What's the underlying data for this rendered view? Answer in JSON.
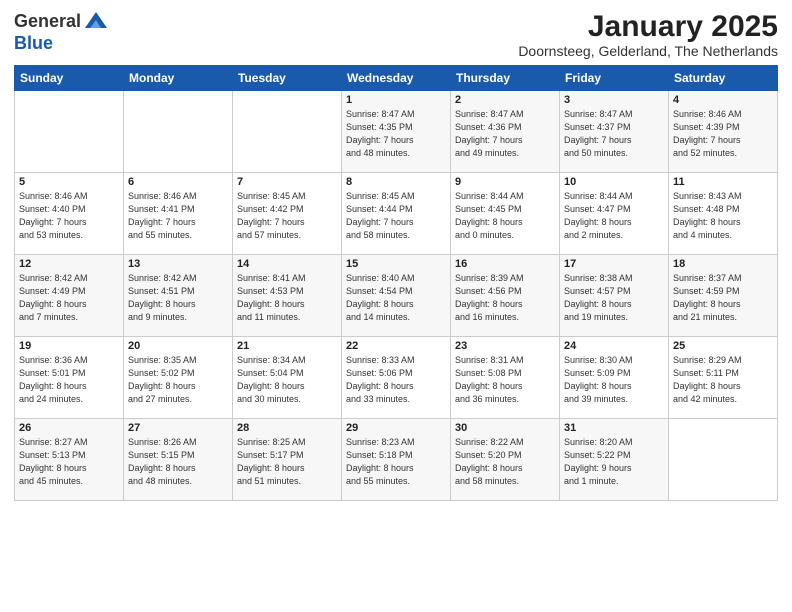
{
  "logo": {
    "line1": "General",
    "line2": "Blue"
  },
  "title": "January 2025",
  "subtitle": "Doornsteeg, Gelderland, The Netherlands",
  "weekdays": [
    "Sunday",
    "Monday",
    "Tuesday",
    "Wednesday",
    "Thursday",
    "Friday",
    "Saturday"
  ],
  "weeks": [
    [
      {
        "day": "",
        "info": ""
      },
      {
        "day": "",
        "info": ""
      },
      {
        "day": "",
        "info": ""
      },
      {
        "day": "1",
        "info": "Sunrise: 8:47 AM\nSunset: 4:35 PM\nDaylight: 7 hours\nand 48 minutes."
      },
      {
        "day": "2",
        "info": "Sunrise: 8:47 AM\nSunset: 4:36 PM\nDaylight: 7 hours\nand 49 minutes."
      },
      {
        "day": "3",
        "info": "Sunrise: 8:47 AM\nSunset: 4:37 PM\nDaylight: 7 hours\nand 50 minutes."
      },
      {
        "day": "4",
        "info": "Sunrise: 8:46 AM\nSunset: 4:39 PM\nDaylight: 7 hours\nand 52 minutes."
      }
    ],
    [
      {
        "day": "5",
        "info": "Sunrise: 8:46 AM\nSunset: 4:40 PM\nDaylight: 7 hours\nand 53 minutes."
      },
      {
        "day": "6",
        "info": "Sunrise: 8:46 AM\nSunset: 4:41 PM\nDaylight: 7 hours\nand 55 minutes."
      },
      {
        "day": "7",
        "info": "Sunrise: 8:45 AM\nSunset: 4:42 PM\nDaylight: 7 hours\nand 57 minutes."
      },
      {
        "day": "8",
        "info": "Sunrise: 8:45 AM\nSunset: 4:44 PM\nDaylight: 7 hours\nand 58 minutes."
      },
      {
        "day": "9",
        "info": "Sunrise: 8:44 AM\nSunset: 4:45 PM\nDaylight: 8 hours\nand 0 minutes."
      },
      {
        "day": "10",
        "info": "Sunrise: 8:44 AM\nSunset: 4:47 PM\nDaylight: 8 hours\nand 2 minutes."
      },
      {
        "day": "11",
        "info": "Sunrise: 8:43 AM\nSunset: 4:48 PM\nDaylight: 8 hours\nand 4 minutes."
      }
    ],
    [
      {
        "day": "12",
        "info": "Sunrise: 8:42 AM\nSunset: 4:49 PM\nDaylight: 8 hours\nand 7 minutes."
      },
      {
        "day": "13",
        "info": "Sunrise: 8:42 AM\nSunset: 4:51 PM\nDaylight: 8 hours\nand 9 minutes."
      },
      {
        "day": "14",
        "info": "Sunrise: 8:41 AM\nSunset: 4:53 PM\nDaylight: 8 hours\nand 11 minutes."
      },
      {
        "day": "15",
        "info": "Sunrise: 8:40 AM\nSunset: 4:54 PM\nDaylight: 8 hours\nand 14 minutes."
      },
      {
        "day": "16",
        "info": "Sunrise: 8:39 AM\nSunset: 4:56 PM\nDaylight: 8 hours\nand 16 minutes."
      },
      {
        "day": "17",
        "info": "Sunrise: 8:38 AM\nSunset: 4:57 PM\nDaylight: 8 hours\nand 19 minutes."
      },
      {
        "day": "18",
        "info": "Sunrise: 8:37 AM\nSunset: 4:59 PM\nDaylight: 8 hours\nand 21 minutes."
      }
    ],
    [
      {
        "day": "19",
        "info": "Sunrise: 8:36 AM\nSunset: 5:01 PM\nDaylight: 8 hours\nand 24 minutes."
      },
      {
        "day": "20",
        "info": "Sunrise: 8:35 AM\nSunset: 5:02 PM\nDaylight: 8 hours\nand 27 minutes."
      },
      {
        "day": "21",
        "info": "Sunrise: 8:34 AM\nSunset: 5:04 PM\nDaylight: 8 hours\nand 30 minutes."
      },
      {
        "day": "22",
        "info": "Sunrise: 8:33 AM\nSunset: 5:06 PM\nDaylight: 8 hours\nand 33 minutes."
      },
      {
        "day": "23",
        "info": "Sunrise: 8:31 AM\nSunset: 5:08 PM\nDaylight: 8 hours\nand 36 minutes."
      },
      {
        "day": "24",
        "info": "Sunrise: 8:30 AM\nSunset: 5:09 PM\nDaylight: 8 hours\nand 39 minutes."
      },
      {
        "day": "25",
        "info": "Sunrise: 8:29 AM\nSunset: 5:11 PM\nDaylight: 8 hours\nand 42 minutes."
      }
    ],
    [
      {
        "day": "26",
        "info": "Sunrise: 8:27 AM\nSunset: 5:13 PM\nDaylight: 8 hours\nand 45 minutes."
      },
      {
        "day": "27",
        "info": "Sunrise: 8:26 AM\nSunset: 5:15 PM\nDaylight: 8 hours\nand 48 minutes."
      },
      {
        "day": "28",
        "info": "Sunrise: 8:25 AM\nSunset: 5:17 PM\nDaylight: 8 hours\nand 51 minutes."
      },
      {
        "day": "29",
        "info": "Sunrise: 8:23 AM\nSunset: 5:18 PM\nDaylight: 8 hours\nand 55 minutes."
      },
      {
        "day": "30",
        "info": "Sunrise: 8:22 AM\nSunset: 5:20 PM\nDaylight: 8 hours\nand 58 minutes."
      },
      {
        "day": "31",
        "info": "Sunrise: 8:20 AM\nSunset: 5:22 PM\nDaylight: 9 hours\nand 1 minute."
      },
      {
        "day": "",
        "info": ""
      }
    ]
  ]
}
